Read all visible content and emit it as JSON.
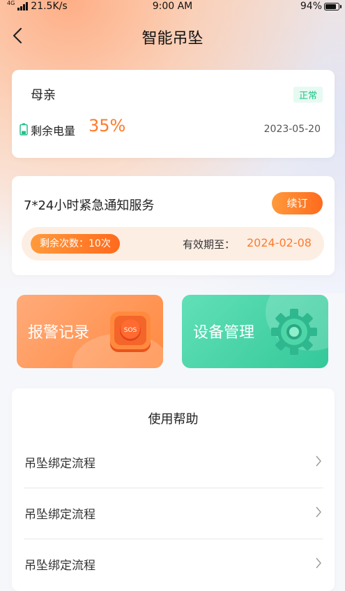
{
  "status_bar": {
    "network_type": "4G",
    "speed": "21.5K/s",
    "time": "9:00 AM",
    "battery_percent": "94%",
    "battery_level": 0.94
  },
  "header": {
    "title": "智能吊坠",
    "back_icon": "chevron-left-icon"
  },
  "device_card": {
    "name": "母亲",
    "status": "正常",
    "battery_label": "剩余电量",
    "battery_value": "35%",
    "battery_level": 0.35,
    "date": "2023-05-20"
  },
  "service_card": {
    "title": "7*24小时紧急通知服务",
    "renew_label": "续订",
    "remaining_label": "剩余次数：10次",
    "expire_label": "有效期至：",
    "expire_value": "2024-02-08"
  },
  "tiles": {
    "alarm_label": "报警记录",
    "alarm_icon": "sos-icon",
    "device_label": "设备管理",
    "device_icon": "gear-icon"
  },
  "help": {
    "title": "使用帮助",
    "items": [
      {
        "label": "吊坠绑定流程"
      },
      {
        "label": "吊坠绑定流程"
      },
      {
        "label": "吊坠绑定流程"
      }
    ]
  },
  "colors": {
    "accent_orange": "#ff7a2a",
    "status_green": "#22c08a",
    "device_tile": "#33c899",
    "alarm_tile": "#ff8940"
  }
}
